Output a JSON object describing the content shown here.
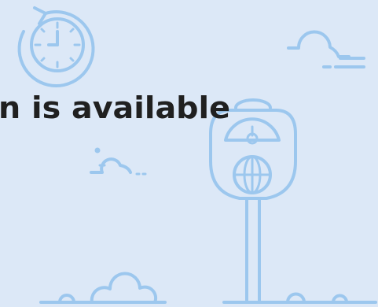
{
  "headline": {
    "text": "n is available"
  },
  "colors": {
    "background": "#dce8f7",
    "illustration_stroke": "#9cc7ee",
    "headline_text": "#202020"
  },
  "icons": {
    "clock": "clock-icon",
    "parking_meter": "parking-meter-icon",
    "cloud": "cloud-icon"
  }
}
